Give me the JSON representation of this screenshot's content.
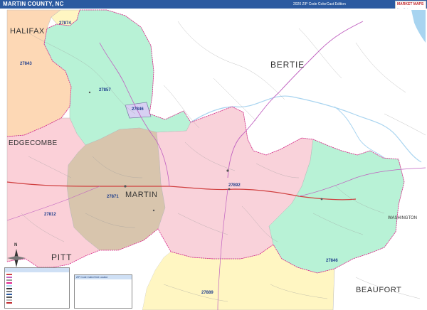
{
  "header": {
    "title": "MARTIN COUNTY, NC",
    "edition": "2020 ZIP Code ColorCast Edition",
    "logo_main": "MARKET MAPS",
    "logo_sub": "Map Sales"
  },
  "map": {
    "counties": [
      {
        "name": "HALIFAX",
        "color": "#333333"
      },
      {
        "name": "BERTIE",
        "color": "#333333"
      },
      {
        "name": "EDGECOMBE",
        "color": "#333333"
      },
      {
        "name": "MARTIN",
        "color": "#333333"
      },
      {
        "name": "WASHINGTON",
        "color": "#333333"
      },
      {
        "name": "PITT",
        "color": "#333333"
      },
      {
        "name": "BEAUFORT",
        "color": "#333333"
      }
    ],
    "zip_codes": [
      {
        "code": "27874",
        "fill": "#fff6c2"
      },
      {
        "code": "27843",
        "fill": "#fdd8b5"
      },
      {
        "code": "27857",
        "fill": "#b8f2d6"
      },
      {
        "code": "27846",
        "fill": "#d7d0f2"
      },
      {
        "code": "27871",
        "fill": "#d8c5ad"
      },
      {
        "code": "27892",
        "fill": "#f9d2da"
      },
      {
        "code": "27812",
        "fill": "#fbd0d8"
      },
      {
        "code": "27846",
        "fill": "#b8f2d6"
      },
      {
        "code": "27889",
        "fill": "#fff6c2"
      }
    ],
    "water_color": "#a8d4f0",
    "zip_label_color": "#1f3e8c"
  },
  "legend": {
    "title": "",
    "rows": [
      "",
      "",
      "",
      "",
      "",
      "",
      "",
      "",
      "",
      "",
      ""
    ],
    "zip_title": "ZIP Code Index/Grid Locator",
    "zip_rows": [
      "",
      "",
      "",
      "",
      "",
      "",
      "",
      "",
      ""
    ]
  },
  "compass": {
    "north": "N"
  }
}
